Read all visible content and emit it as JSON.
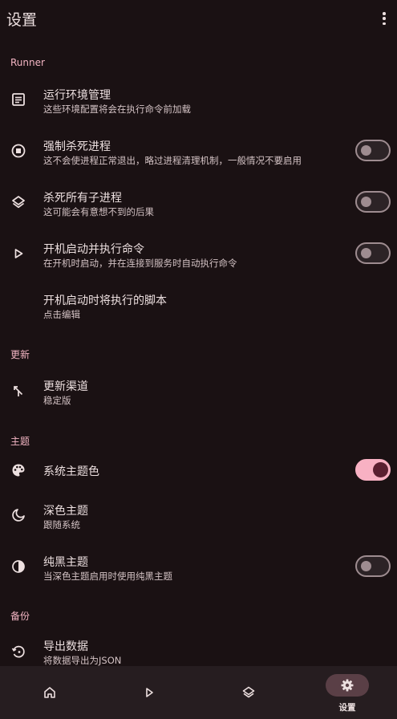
{
  "header": {
    "title": "设置",
    "more_icon": "more-vert-icon"
  },
  "sections": {
    "runner": "Runner",
    "update": "更新",
    "theme": "主题",
    "backup": "备份"
  },
  "items": {
    "env": {
      "title": "运行环境管理",
      "subtitle": "这些环境配置将会在执行命令前加载",
      "icon": "article-icon"
    },
    "force_kill": {
      "title": "强制杀死进程",
      "subtitle": "这不会使进程正常退出，略过进程清理机制，一般情况不要启用",
      "icon": "stop-circle-icon",
      "enabled": false
    },
    "kill_children": {
      "title": "杀死所有子进程",
      "subtitle": "这可能会有意想不到的后果",
      "icon": "layers-icon",
      "enabled": false
    },
    "boot_run": {
      "title": "开机启动并执行命令",
      "subtitle": "在开机时启动，并在连接到服务时自动执行命令",
      "icon": "play-icon",
      "enabled": false
    },
    "boot_script": {
      "title": "开机启动时将执行的脚本",
      "subtitle": "点击编辑"
    },
    "channel": {
      "title": "更新渠道",
      "subtitle": "稳定版",
      "icon": "merge-icon"
    },
    "system_color": {
      "title": "系统主题色",
      "icon": "palette-icon",
      "enabled": true
    },
    "dark_theme": {
      "title": "深色主题",
      "subtitle": "跟随系统",
      "icon": "moon-icon"
    },
    "pure_black": {
      "title": "纯黑主题",
      "subtitle": "当深色主题启用时使用纯黑主题",
      "icon": "contrast-icon",
      "enabled": false
    },
    "export": {
      "title": "导出数据",
      "subtitle": "将数据导出为JSON",
      "icon": "restore-icon"
    }
  },
  "nav": {
    "home_icon": "home-icon",
    "run_icon": "play-icon",
    "layers_icon": "layers-icon",
    "settings_icon": "gear-icon",
    "settings_label": "设置",
    "active": "settings"
  },
  "colors": {
    "background": "#1a1113",
    "accent": "#f8b1c3",
    "section_header": "#f3b5c3",
    "nav_background": "#261d20"
  }
}
